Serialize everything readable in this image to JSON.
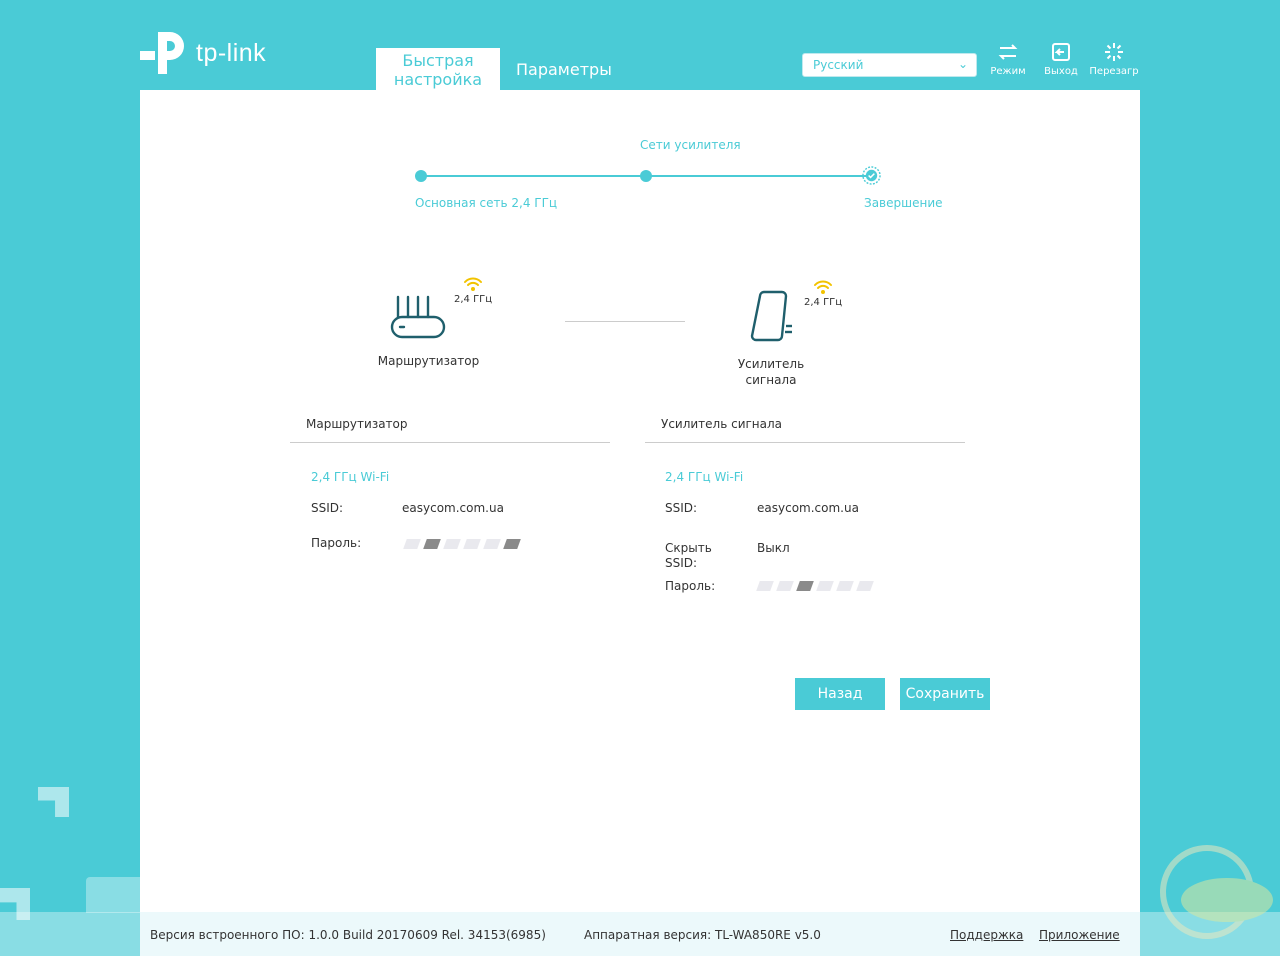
{
  "header": {
    "logo_text": "tp-link",
    "tabs": [
      {
        "label": "Быстрая настройка",
        "active": true
      },
      {
        "label": "Параметры",
        "active": false
      }
    ],
    "language": {
      "selected": "Русский"
    },
    "buttons": [
      {
        "label": "Режим",
        "icon": "mode-switch-icon"
      },
      {
        "label": "Выход",
        "icon": "logout-icon"
      },
      {
        "label": "Перезагр",
        "icon": "reboot-icon"
      }
    ]
  },
  "steps": {
    "current_title": "Сети усилителя",
    "step1": "Основная сеть 2,4 ГГц",
    "step3": "Завершение"
  },
  "devices": {
    "router": {
      "label": "Маршрутизатор",
      "band": "2,4 ГГц"
    },
    "extender": {
      "label": "Усилитель сигнала",
      "band": "2,4 ГГц"
    }
  },
  "router_section": {
    "title": "Маршрутизатор",
    "band": "2,4 ГГц Wi-Fi",
    "ssid_label": "SSID:",
    "ssid_value": "easycom.com.ua",
    "password_label": "Пароль:"
  },
  "extender_section": {
    "title": "Усилитель сигнала",
    "band": "2,4 ГГц Wi-Fi",
    "ssid_label": "SSID:",
    "ssid_value": "easycom.com.ua",
    "hide_ssid_label": "Скрыть SSID:",
    "hide_ssid_value": "Выкл",
    "password_label": "Пароль:"
  },
  "actions": {
    "back": "Назад",
    "save": "Сохранить"
  },
  "footer": {
    "firmware": "Версия встроенного ПО: 1.0.0 Build 20170609 Rel. 34153(6985)",
    "hardware": "Аппаратная версия: TL-WA850RE v5.0",
    "support": "Поддержка",
    "app": "Приложение"
  },
  "colors": {
    "accent": "#4acbd6",
    "wifi": "#f2c300"
  }
}
